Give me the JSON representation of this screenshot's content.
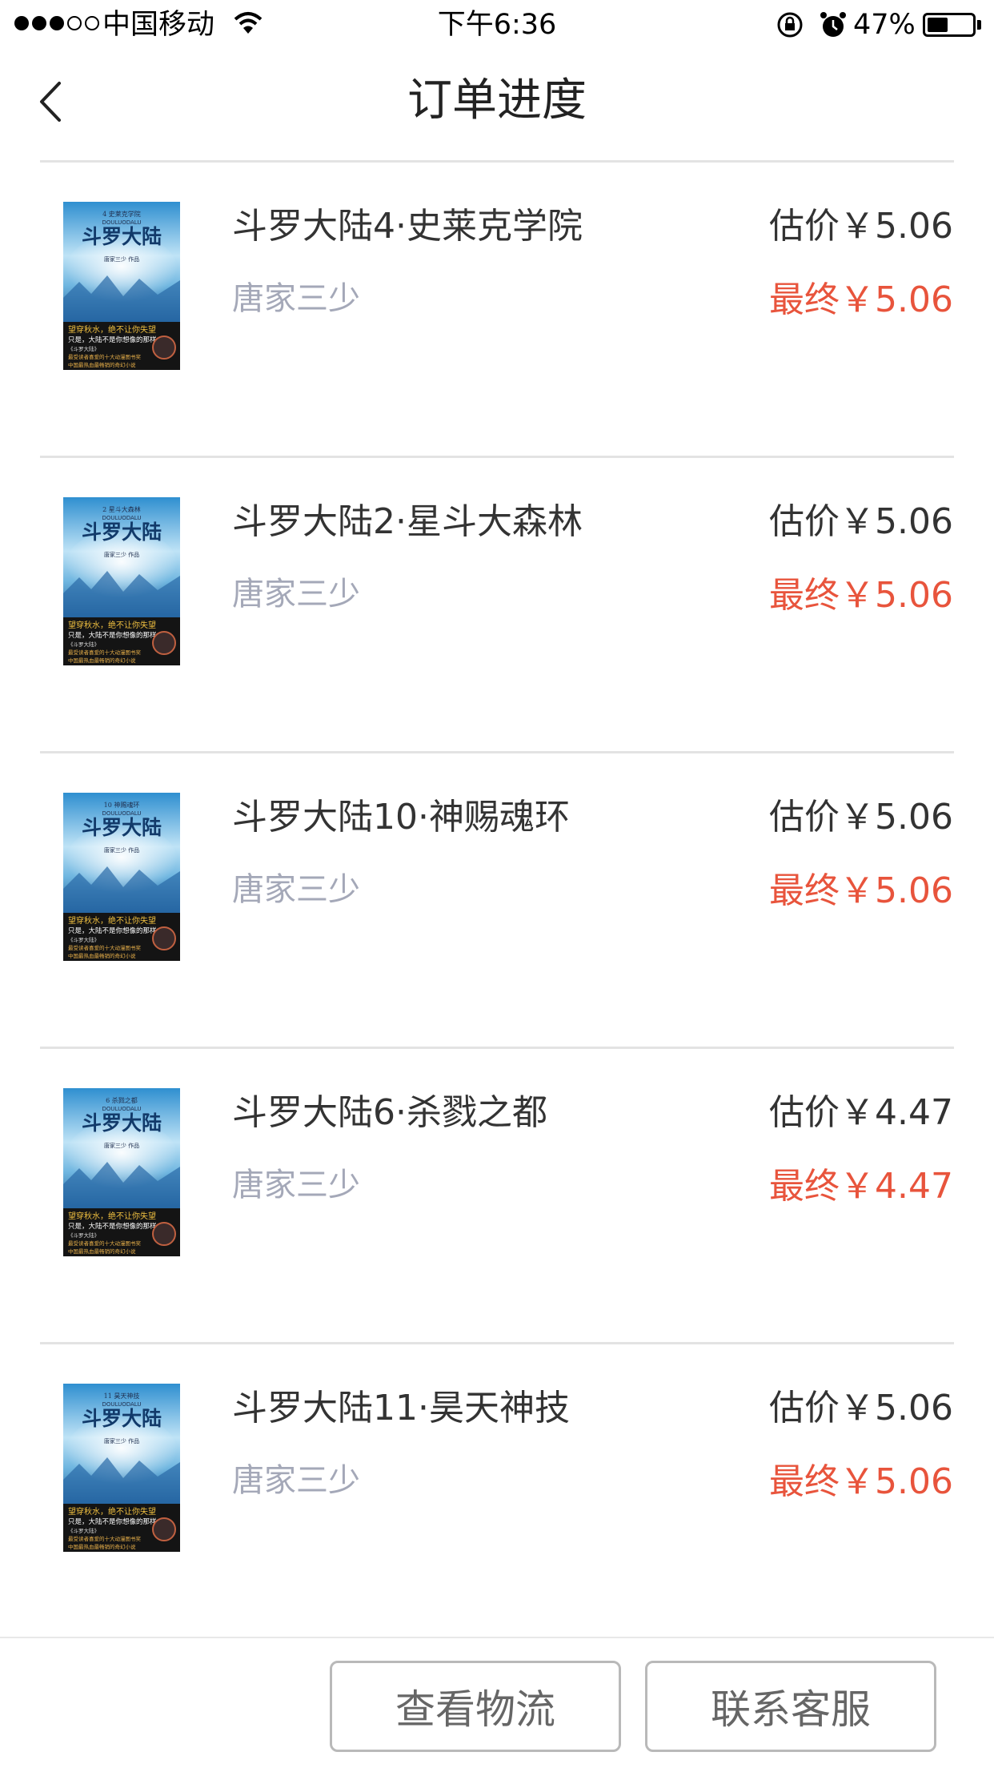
{
  "status_bar": {
    "carrier": "中国移动",
    "time": "下午6:36",
    "battery_percent_text": "47%",
    "battery_level": 0.47,
    "signal_bars_filled": 3,
    "signal_bars_total": 5
  },
  "nav": {
    "title": "订单进度",
    "back_icon": "chevron-left-icon"
  },
  "orders": [
    {
      "title": "斗罗大陆4·史莱克学院",
      "author": "唐家三少",
      "estimate": "估价￥5.06",
      "final": "最终￥5.06",
      "cover_top_text": "4 史莱克学院"
    },
    {
      "title": "斗罗大陆2·星斗大森林",
      "author": "唐家三少",
      "estimate": "估价￥5.06",
      "final": "最终￥5.06",
      "cover_top_text": "2 星斗大森林"
    },
    {
      "title": "斗罗大陆10·神赐魂环",
      "author": "唐家三少",
      "estimate": "估价￥5.06",
      "final": "最终￥5.06",
      "cover_top_text": "10 神赐魂环"
    },
    {
      "title": "斗罗大陆6·杀戮之都",
      "author": "唐家三少",
      "estimate": "估价￥4.47",
      "final": "最终￥4.47",
      "cover_top_text": "6 杀戮之都"
    },
    {
      "title": "斗罗大陆11·昊天神技",
      "author": "唐家三少",
      "estimate": "估价￥5.06",
      "final": "最终￥5.06",
      "cover_top_text": "11 昊天神技"
    }
  ],
  "cover": {
    "series_title": "斗罗大陆",
    "pinyin": "DOULUODALU",
    "byline": "唐家三少 作品",
    "slogan_1": "望穿秋水，绝不让你失望",
    "slogan_2": "只是，大陆不是你想像的那样",
    "tagline_1": "《斗罗大陆》",
    "tagline_2": "最受读者喜爱的十大动漫图书奖",
    "tagline_3": "中国最热血最畅销的奇幻小说"
  },
  "footer": {
    "logistics_button": "查看物流",
    "service_button": "联系客服"
  },
  "colors": {
    "accent_red": "#e8543c",
    "author_gray": "#a4a8b8",
    "divider": "#e3e3e3"
  }
}
